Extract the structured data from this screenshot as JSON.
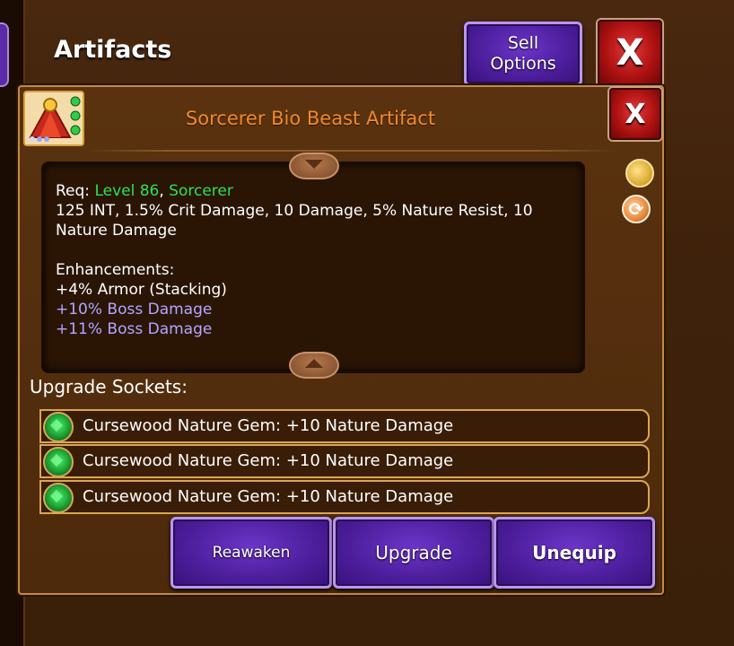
{
  "header": {
    "title": "Artifacts",
    "sell_options_label": "Sell\nOptions",
    "close_label": "X"
  },
  "item": {
    "name": "Sorcerer Bio Beast Artifact",
    "close_label": "X",
    "req_prefix": "Req: ",
    "req_level": "Level 86",
    "req_sep": ", ",
    "req_class": "Sorcerer",
    "stats": "125 INT, 1.5% Crit Damage, 10 Damage, 5% Nature Resist, 10 Nature Damage",
    "enhancements_label": "Enhancements:",
    "enhancements": [
      "+4% Armor (Stacking)"
    ],
    "enhancements_highlight": [
      "+10% Boss Damage",
      "+11% Boss Damage"
    ]
  },
  "sockets": {
    "label": "Upgrade Sockets:",
    "items": [
      "Cursewood Nature Gem: +10 Nature Damage",
      "Cursewood Nature Gem: +10 Nature Damage",
      "Cursewood Nature Gem: +10 Nature Damage"
    ]
  },
  "actions": {
    "reawaken": "Reawaken",
    "upgrade": "Upgrade",
    "unequip": "Unequip"
  },
  "colors": {
    "background": "#3f220b",
    "item_name": "#f08a2e",
    "req_green": "#2fe14b",
    "highlight_lavender": "#b3a6ff",
    "button_purple": "#4e1f9e",
    "close_red": "#b01212"
  },
  "icons": {
    "artifact": "artifact-icon",
    "gold_bag": "gold-bag-icon",
    "recycle": "recycle-icon",
    "gem": "nature-gem-icon",
    "scroll_up": "scroll-up-icon",
    "scroll_down": "scroll-down-icon"
  }
}
